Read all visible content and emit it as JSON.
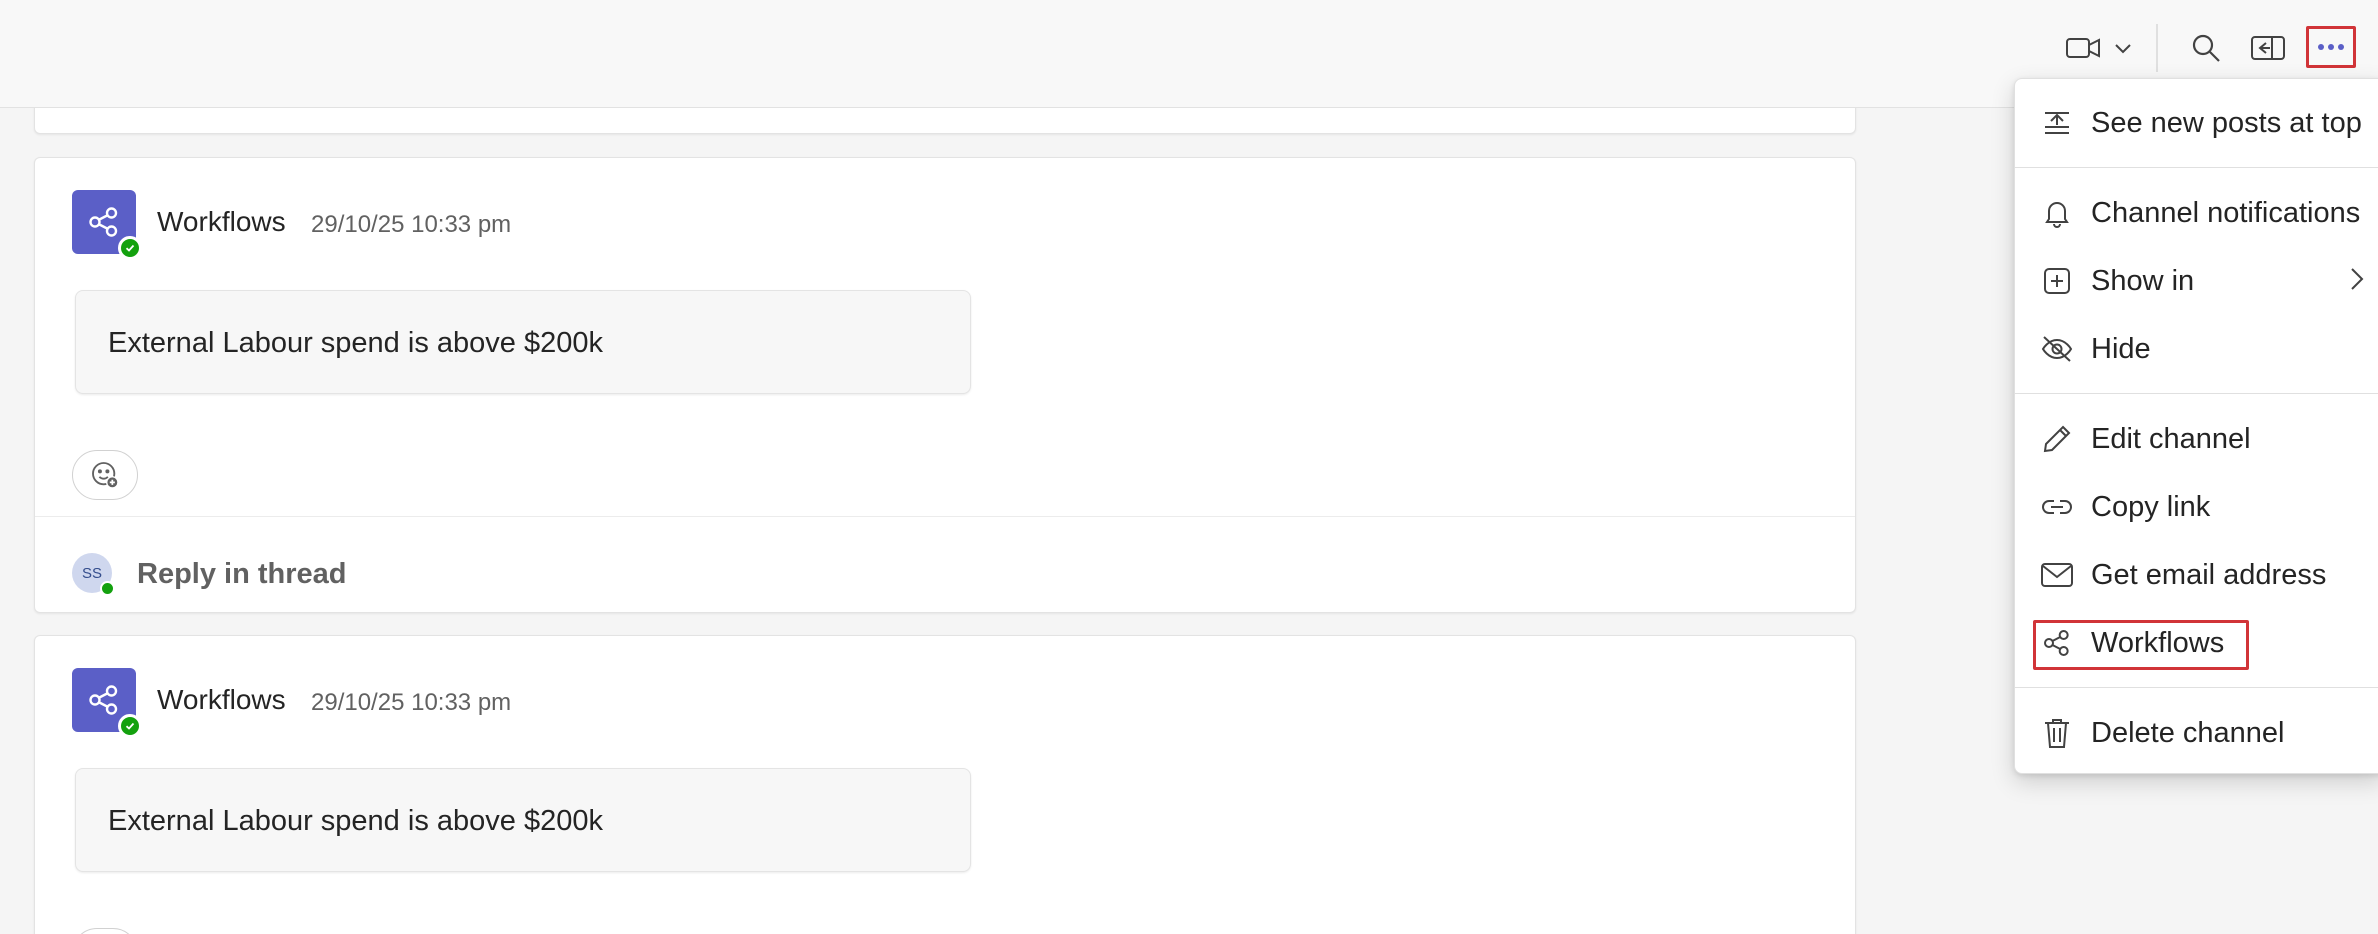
{
  "menu": {
    "items": [
      {
        "label": "See new posts at top",
        "icon": "arrow-to-top-icon"
      },
      {
        "label": "Channel notifications",
        "icon": "bell-icon"
      },
      {
        "label": "Show in",
        "icon": "add-square-icon"
      },
      {
        "label": "Hide",
        "icon": "eye-off-icon"
      },
      {
        "label": "Edit channel",
        "icon": "pencil-icon"
      },
      {
        "label": "Copy link",
        "icon": "link-icon"
      },
      {
        "label": "Get email address",
        "icon": "mail-icon"
      },
      {
        "label": "Workflows",
        "icon": "workflows-icon"
      },
      {
        "label": "Delete channel",
        "icon": "trash-icon"
      }
    ]
  },
  "posts": [
    {
      "author": "Workflows",
      "timestamp": "29/10/25 10:33 pm",
      "message": "External Labour spend is above $200k"
    },
    {
      "author": "Workflows",
      "timestamp": "29/10/25 10:33 pm",
      "message": "External Labour spend is above $200k"
    }
  ],
  "reply": {
    "avatar_initials": "SS",
    "label": "Reply in thread"
  },
  "colors": {
    "accent": "#5b5fc7",
    "highlight": "#d13438",
    "presence": "#13a10e"
  }
}
